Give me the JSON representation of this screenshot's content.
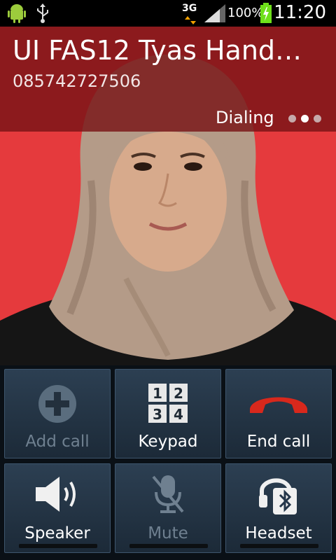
{
  "status_bar": {
    "network": "3G",
    "battery": "100%",
    "time": "11:20"
  },
  "call": {
    "name": "UI FAS12 Tyas Hand…",
    "number": "085742727506",
    "state": "Dialing"
  },
  "buttons": {
    "add_call": "Add call",
    "keypad": "Keypad",
    "end_call": "End call",
    "speaker": "Speaker",
    "mute": "Mute",
    "headset": "Headset"
  },
  "keypad_digits": [
    "1",
    "2",
    "3",
    "4"
  ],
  "colors": {
    "header_overlay": "#7a1416",
    "photo_background": "#e53a3d",
    "end_call_icon": "#d8281c",
    "panel_button": "#24364a",
    "battery": "#6ee01a"
  }
}
